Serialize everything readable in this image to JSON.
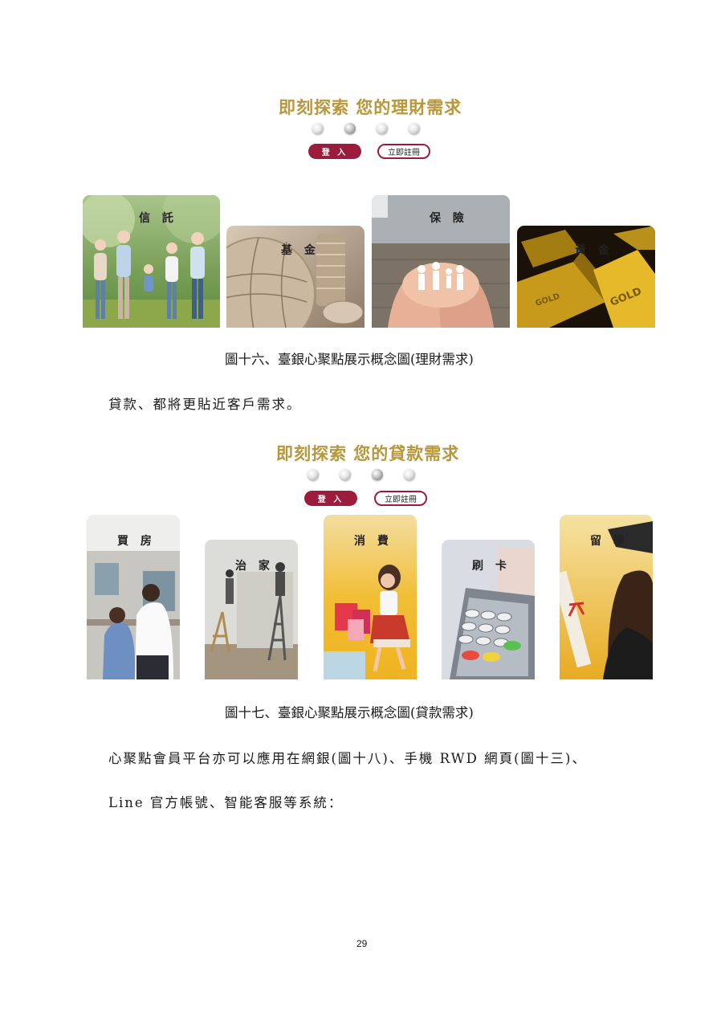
{
  "figure16": {
    "title": "即刻探索 您的理財需求",
    "login_label": "登 入",
    "register_label": "立即註冊",
    "cards": [
      {
        "label": "信 託"
      },
      {
        "label": "基 金"
      },
      {
        "label": "保 險"
      },
      {
        "label": "黃 金"
      }
    ],
    "caption": "圖十六、臺銀心聚點展示概念圖(理財需求)"
  },
  "paragraph1": "貸款、都將更貼近客戶需求。",
  "figure17": {
    "title": "即刻探索 您的貸款需求",
    "login_label": "登 入",
    "register_label": "立即註冊",
    "cards": [
      {
        "label": "買 房"
      },
      {
        "label": "治 家"
      },
      {
        "label": "消 費"
      },
      {
        "label": "刷 卡"
      },
      {
        "label": "留 學"
      }
    ],
    "caption": "圖十七、臺銀心聚點展示概念圖(貸款需求)"
  },
  "paragraph2": "心聚點會員平台亦可以應用在網銀(圖十八)、手機 RWD 網頁(圖十三)、",
  "paragraph3": "Line 官方帳號、智能客服等系統：",
  "page_number": "29"
}
